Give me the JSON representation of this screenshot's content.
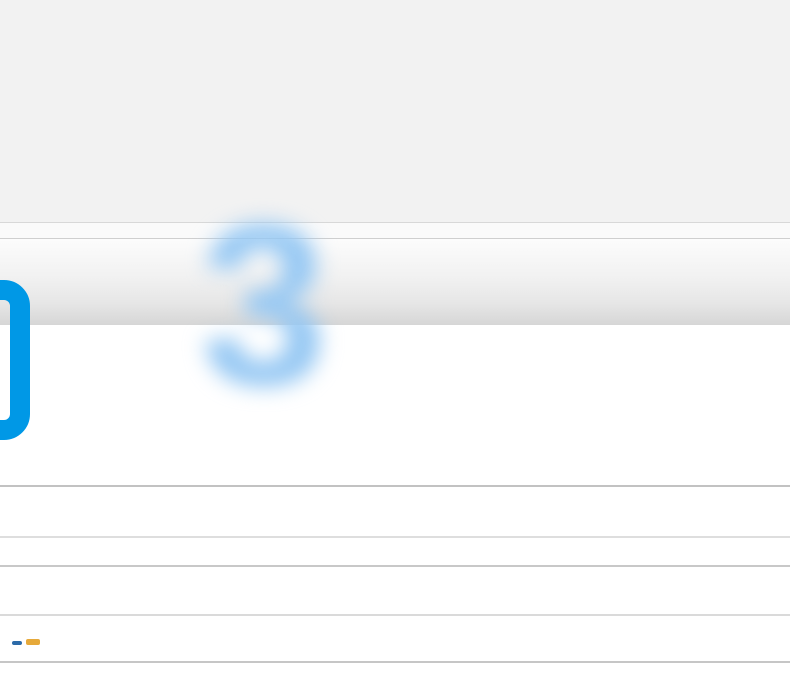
{
  "watermark": {
    "digit": "3"
  },
  "colors": {
    "panel_bg": "#f2f2f2",
    "digit_blue": "#94c7f3",
    "edge_blue": "#0098e6",
    "rule_grey": "#c8c8c8"
  }
}
